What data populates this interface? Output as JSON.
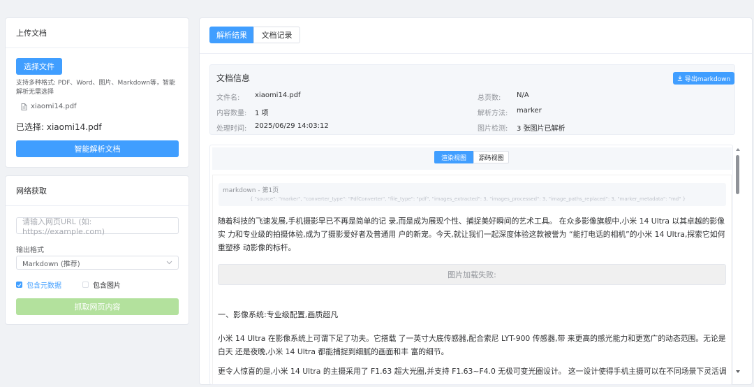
{
  "upload": {
    "title": "上传文档",
    "choose_button": "选择文件",
    "hint": "支持多种格式: PDF、Word、图片、Markdown等，智能解析无需选择",
    "file_name": "xiaomi14.pdf",
    "selected_text": "已选择: xiaomi14.pdf",
    "parse_button": "智能解析文档"
  },
  "web": {
    "title": "网络获取",
    "url_placeholder": "请输入网页URL (如: https://example.com)",
    "format_label": "输出格式",
    "format_value": "Markdown (推荐)",
    "include_meta_label": "包含元数据",
    "include_meta_checked": true,
    "include_images_label": "包含图片",
    "include_images_checked": false,
    "fetch_button": "抓取网页内容"
  },
  "main": {
    "tabs": [
      {
        "label": "解析结果",
        "active": true
      },
      {
        "label": "文档记录",
        "active": false
      }
    ]
  },
  "doc_info": {
    "title": "文档信息",
    "export_button": "导出markdown",
    "left": [
      {
        "label": "文件名:",
        "value": "xiaomi14.pdf"
      },
      {
        "label": "内容数量:",
        "value": "1 项"
      },
      {
        "label": "处理时间:",
        "value": "2025/06/29 14:03:12"
      }
    ],
    "right": [
      {
        "label": "总页数:",
        "value": "N/A"
      },
      {
        "label": "解析方法:",
        "value": "marker"
      },
      {
        "label": "图片检测:",
        "value": "3 张图片已解析"
      }
    ]
  },
  "view_toggle": {
    "render": "渲染视图",
    "source": "源码视图"
  },
  "content": {
    "section_label": "markdown - 第1页",
    "meta_json": "{ \"source\": \"marker\", \"converter_type\": \"PdfConverter\", \"file_type\": \"pdf\", \"images_extracted\": 3, \"images_processed\": 3, \"image_paths_replaced\": 3, \"marker_metadata\": \"md\" }",
    "para1": "随着科技的飞速发展,手机摄影早已不再是简单的记 录,而是成为展现个性、捕捉美好瞬间的艺术工具。 在众多影像旗舰中,小米 14 Ultra 以其卓越的影像实 力和专业级的拍摄体验,成为了摄影爱好者及普通用 户的新宠。今天,就让我们一起深度体验这款被誉为 “能打电话的相机”的小米 14 Ultra,探索它如何重塑移 动影像的标杆。",
    "image_fail": "图片加载失败:",
    "heading1": "一、影像系统:专业级配置,画质超凡",
    "para2": "小米 14 Ultra 在影像系统上可谓下足了功夫。它搭载 了一英寸大底传感器,配合索尼 LYT-900 传感器,带 来更高的感光能力和更宽广的动态范围。无论是白天 还是夜晚,小米 14 Ultra 都能捕捉到细腻的画面和丰 富的细节。",
    "para3": "更令人惊喜的是,小米 14 Ultra 的主摄采用了 F1.63 超大光圈,并支持 F1.63~F4.0 无极可变光圈设计。 这一设计使得手机主摄可以在不同场景下灵活调整光 圈"
  }
}
